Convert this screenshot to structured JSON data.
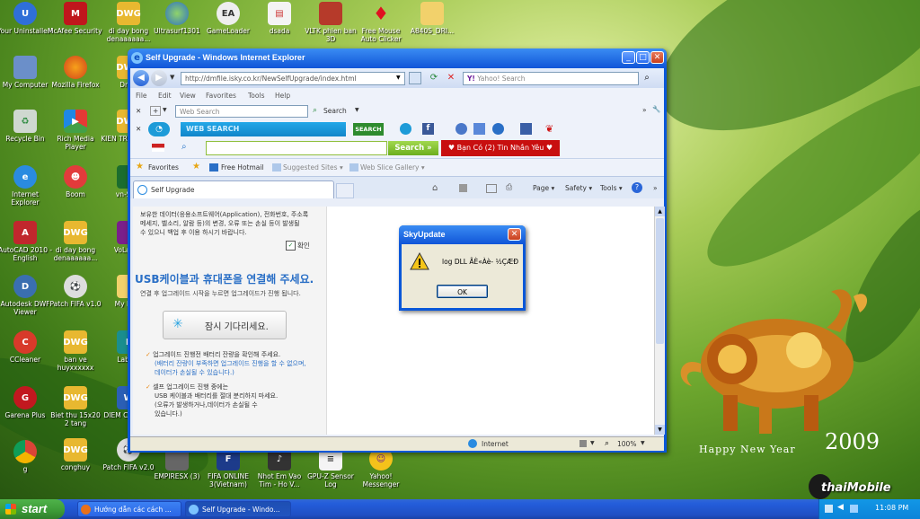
{
  "desktop": {
    "icons_col1": [
      "Your Uninstaller!",
      "My Computer",
      "Recycle Bin",
      "Internet Explorer",
      "AutoCAD 2010 - English",
      "Autodesk DWF Viewer",
      "CCleaner",
      "Garena Plus",
      "g"
    ],
    "icons_col2": [
      "McAfee Security Sc...",
      "Mozilla Firefox",
      "Rich Media Player",
      "Boom",
      "di day bong denaaaaaa...",
      "Patch FIFA v1.0",
      "ban ve huyxxxxxx",
      "Biet thu 15x20 2 tang",
      "conghuy"
    ],
    "icons_col3": [
      "di day bong denaaaaaa...",
      "Draw",
      "KIEN TR... SO 29",
      "vn-Sa...",
      "VoLam...",
      "My Do...",
      "Laba...",
      "DIEM C... DH 2",
      "Patch FIFA v2.0"
    ],
    "icons_top": [
      "Ultrasurf1301",
      "GameLoader",
      "dsada",
      "VLTK phien ban 3D",
      "Free Mouse Auto Clicker",
      "A840S_DRI..."
    ],
    "icons_bottom": [
      "EMPIRESX (3)",
      "FIFA ONLINE 3(Vietnam)",
      "Nhot Em Vao Tim - Ho V...",
      "GPU-Z Sensor Log",
      "Yahoo! Messenger"
    ],
    "wallpaper_text": "Happy New Year",
    "wallpaper_year": "2009",
    "watermark": "thaiMobile"
  },
  "ie": {
    "title": "Self Upgrade - Windows Internet Explorer",
    "url": "http://dmfile.isky.co.kr/NewSelfUpgrade/index.html",
    "search_placeholder": "Yahoo! Search",
    "menu": [
      "File",
      "Edit",
      "View",
      "Favorites",
      "Tools",
      "Help"
    ],
    "toolbar1": {
      "web_search_placeholder": "Web Search",
      "search_label": "Search"
    },
    "toolbar2": {
      "websearch_brand": "WEB SEARCH",
      "search_btn": "SEARCH"
    },
    "toolbar3": {
      "search_btn": "Search »",
      "promo": "♥ Bạn Có (2) Tin Nhắn Yêu ♥"
    },
    "favorites": {
      "label": "Favorites",
      "hotmail": "Free Hotmail",
      "suggested": "Suggested Sites ▾",
      "slice": "Web Slice Gallery ▾"
    },
    "tab": "Self Upgrade",
    "cmd": {
      "page": "Page ▾",
      "safety": "Safety ▾",
      "tools": "Tools ▾"
    },
    "content": {
      "notice_line1": "보유한 데이터(응용소프트웨어(Application), 전화번호, 주소록",
      "notice_line2": "메세지, 벨소리, 알람 등)의 변경, 오류 또는 손실 등이 발생될",
      "notice_line3": "수 있으니 백업 후 이용 하시기 바랍니다.",
      "confirm": "확인",
      "heading": "USB케이블과 휴대폰을 연결해 주세요.",
      "sub": "연결 후 업그레이드 시작을 누르면 업그레이드가 진행 됩니다.",
      "wait": "잠시 기다리세요.",
      "b1": "업그레이드 진행전 배터리 잔량을 확인해 주세요.",
      "b1a": "(배터리 잔량이 부족하면 업그레이드 진행을 할 수 없으며,",
      "b1b": "데이터가 손실될 수 있습니다.)",
      "b2": "셀프 업그레이드 진행 중에는",
      "b2a": "USB 케이블과 배터리를 절대 분리하지 마세요.",
      "b2b": "(오류가 발생하거나,데이터가 손실될 수",
      "b2c": "있습니다.)"
    },
    "status": {
      "zone": "Internet",
      "zoom": "100%"
    }
  },
  "dialog": {
    "title": "SkyUpdate",
    "message": "log DLL ÃÈ«Àè- ½ÇÆÐ",
    "ok": "OK"
  },
  "taskbar": {
    "start": "start",
    "tasks": [
      "Hướng dẫn các cách ...",
      "Self Upgrade - Windo..."
    ],
    "time": "11:08 PM"
  }
}
